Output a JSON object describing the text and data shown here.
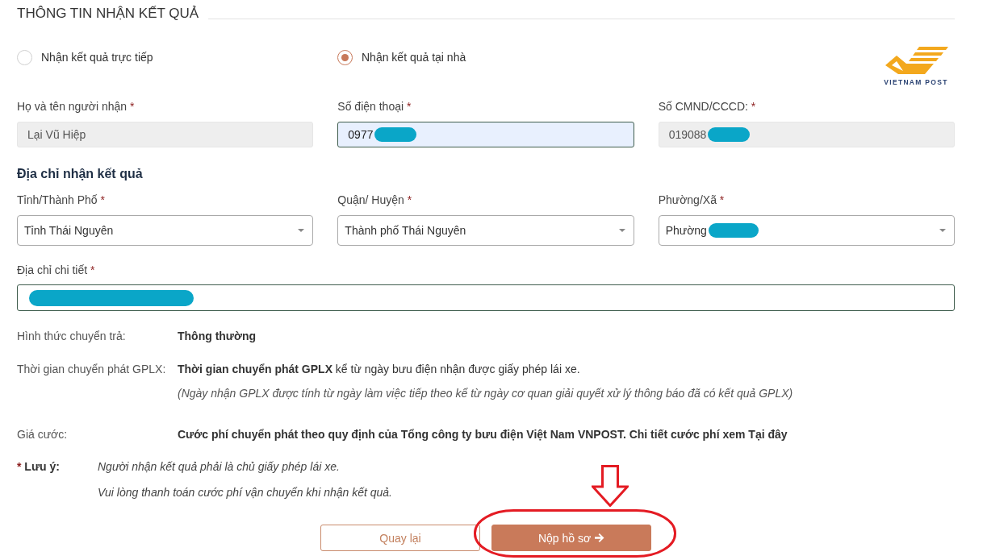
{
  "section_title": "THÔNG TIN NHẬN KẾT QUẢ",
  "delivery_options": [
    {
      "label": "Nhận kết quả trực tiếp",
      "selected": false
    },
    {
      "label": "Nhận kết quả tại nhà",
      "selected": true
    }
  ],
  "carrier_logo": {
    "text": "VIETNAM POST"
  },
  "recipient_fields": [
    {
      "label": "Họ và tên người nhận",
      "required_mark": "*",
      "value": "Lại Vũ Hiệp",
      "disabled": true,
      "autofilled": false,
      "redacted": false
    },
    {
      "label": "Số điện thoại",
      "required_mark": "*",
      "value": "0977",
      "disabled": false,
      "autofilled": true,
      "redacted": true
    },
    {
      "label": "Số CMND/CCCD:",
      "required_mark": "*",
      "value": "019088",
      "disabled": true,
      "autofilled": false,
      "redacted": true
    }
  ],
  "address": {
    "title": "Địa chỉ nhận kết quả",
    "selects": [
      {
        "label": "Tỉnh/Thành Phố",
        "required_mark": "*",
        "value": "Tỉnh Thái Nguyên",
        "redacted": false
      },
      {
        "label": "Quận/ Huyện",
        "required_mark": "*",
        "value": "Thành phố Thái Nguyên",
        "redacted": false
      },
      {
        "label": "Phường/Xã",
        "required_mark": "*",
        "value": "Phường",
        "redacted": true
      }
    ],
    "detail": {
      "label": "Địa chỉ chi tiết",
      "required_mark": "*",
      "redacted": true
    }
  },
  "delivery_info": [
    {
      "label": "Hình thức chuyển trả:",
      "value": "Thông thường",
      "bold": true
    },
    {
      "label": "Thời gian chuyển phát GPLX:",
      "value": "**Thời gian chuyển phát GPLX** kể từ ngày bưu điện nhận được giấy phép lái xe.",
      "bold": false,
      "note": "(Ngày nhận GPLX được tính từ ngày làm việc tiếp theo kể từ ngày cơ quan giải quyết xử lý thông báo đã có kết quả GPLX)"
    },
    {
      "label": "Giá cước:",
      "value": "Cước phí chuyển phát theo quy định của Tổng công ty bưu điện Việt Nam VNPOST. Chi tiết cước phí xem Tại đây",
      "bold": true
    }
  ],
  "note": {
    "mark": "*",
    "label": "Lưu ý:",
    "lines": [
      "Người nhận kết quả phải là chủ giấy phép lái xe.",
      "Vui lòng thanh toán cước phí vận chuyển khi nhận kết quả."
    ]
  },
  "buttons": [
    {
      "label": "Quay lại",
      "kind": "secondary",
      "trailing_arrow": false,
      "highlighted": false
    },
    {
      "label": "Nộp hồ sơ",
      "kind": "primary",
      "trailing_arrow": true,
      "highlighted": true
    }
  ]
}
